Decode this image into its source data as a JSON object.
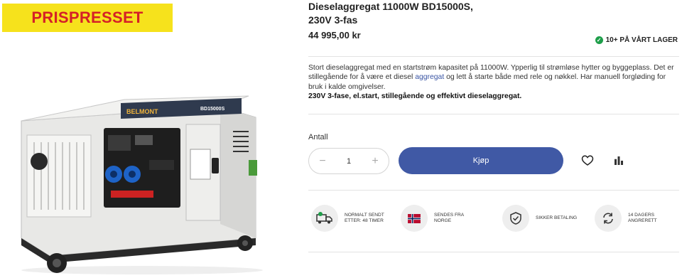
{
  "badge": {
    "label": "PRISPRESSET"
  },
  "product": {
    "title_line1": "Dieselaggregat 11000W BD15000S,",
    "title_line2": "230V 3-fas",
    "price": "44 995,00 kr",
    "stock": "10+ PÅ VÅRT LAGER",
    "description": {
      "part1": "Stort dieselaggregat med en startstrøm kapasitet på 11000W. Ypperlig til strømløse hytter og byggeplass. Det er stillegående for å være et diesel ",
      "link": "aggregat",
      "part2": " og lett å starte både med rele og nøkkel. Har manuell forgløding for bruk i kalde omgivelser.",
      "bold": "230V 3-fase, el.start, stillegående og effektivt dieselaggregat."
    },
    "image_brand": "BELMONT",
    "image_model": "BD15000S"
  },
  "purchase": {
    "qty_label": "Antall",
    "qty_value": "1",
    "minus": "−",
    "plus": "+",
    "buy_label": "Kjøp"
  },
  "features": [
    {
      "line1": "NORMALT SENDT",
      "line2": "ETTER: 48 TIMER",
      "icon": "truck-icon"
    },
    {
      "line1": "SENDES FRA",
      "line2": "NORGE",
      "icon": "norway-flag-icon"
    },
    {
      "line1": "SIKKER BETALING",
      "line2": "",
      "icon": "shield-check-icon"
    },
    {
      "line1": "14 DAGERS",
      "line2": "ANGRERETT",
      "icon": "refresh-icon"
    }
  ],
  "colors": {
    "accent": "#4059a5",
    "badge_bg": "#f6e21c",
    "badge_text": "#d52027",
    "stock": "#1e9e4a"
  }
}
